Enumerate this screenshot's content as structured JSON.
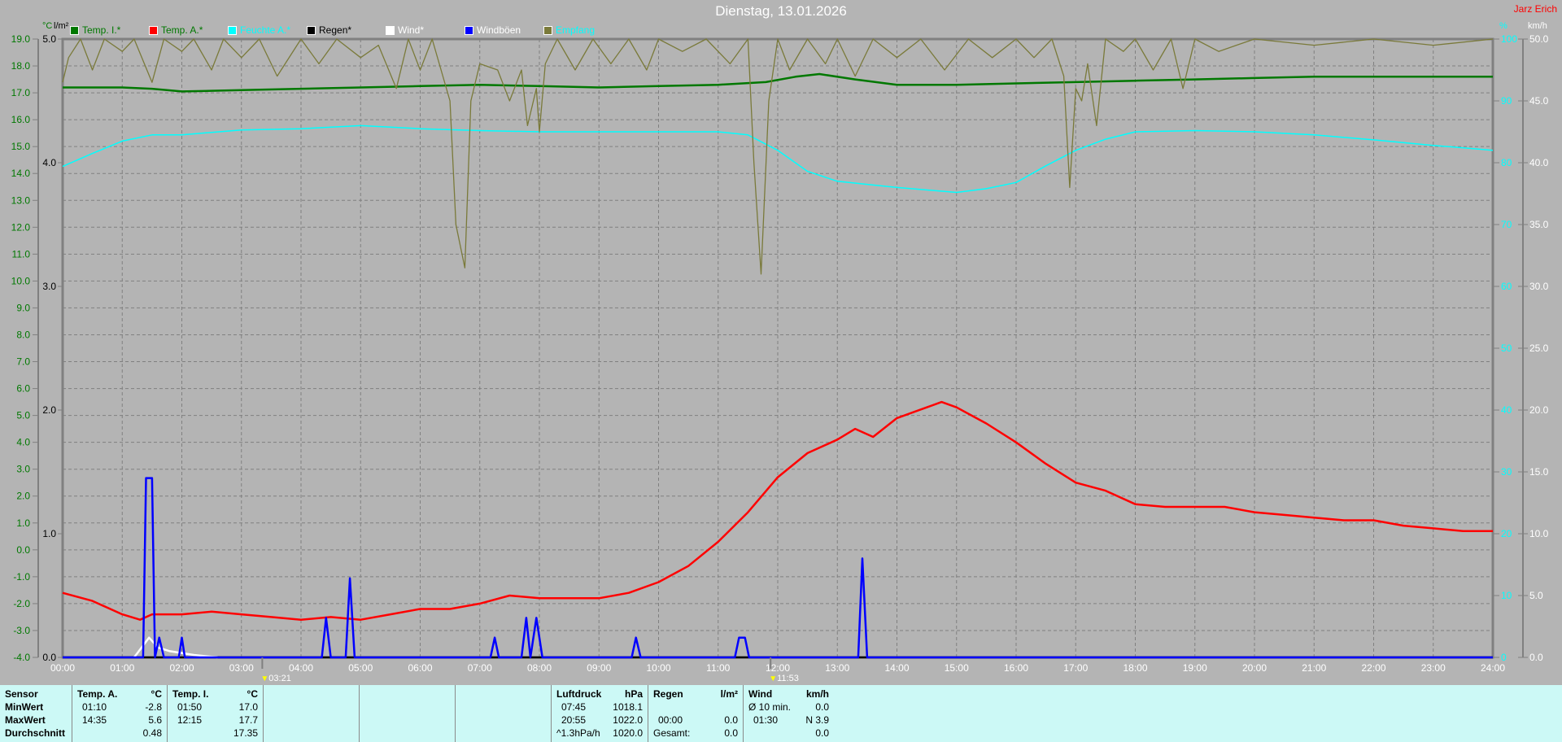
{
  "header": {
    "title": "Dienstag, 13.01.2026",
    "owner": "Jarz Erich"
  },
  "units": {
    "left1": "°C",
    "left2": "l/m²",
    "right1": "%",
    "right2": "km/h"
  },
  "legend": [
    {
      "label": "Temp. I.*",
      "color": "#007800",
      "text_color": "#007800"
    },
    {
      "label": "Temp. A.*",
      "color": "#ff0000",
      "text_color": "#007800"
    },
    {
      "label": "Feuchte A.*",
      "color": "#00ffff",
      "text_color": "#00ffff"
    },
    {
      "label": "Regen*",
      "color": "#000000",
      "text_color": "#000000"
    },
    {
      "label": "Wind*",
      "color": "#ffffff",
      "text_color": "#ffffff"
    },
    {
      "label": "Windböen",
      "color": "#0000ff",
      "text_color": "#ffffff"
    },
    {
      "label": "Empfang",
      "color": "#7a7a3a",
      "text_color": "#00ffff"
    }
  ],
  "markers": [
    {
      "time": "03:21",
      "hour": 3.35
    },
    {
      "time": "11:53",
      "hour": 11.88
    }
  ],
  "chart_data": {
    "type": "line",
    "title": "Dienstag, 13.01.2026",
    "x_range": [
      0,
      24
    ],
    "x_ticks": [
      "00:00",
      "01:00",
      "02:00",
      "03:00",
      "04:00",
      "05:00",
      "06:00",
      "07:00",
      "08:00",
      "09:00",
      "10:00",
      "11:00",
      "12:00",
      "13:00",
      "14:00",
      "15:00",
      "16:00",
      "17:00",
      "18:00",
      "19:00",
      "20:00",
      "21:00",
      "22:00",
      "23:00",
      "24:00"
    ],
    "axes": {
      "temp": {
        "label": "°C",
        "range": [
          -4,
          19
        ],
        "ticks": [
          "19.0",
          "18.0",
          "17.0",
          "16.0",
          "15.0",
          "14.0",
          "13.0",
          "12.0",
          "11.0",
          "10.0",
          "9.0",
          "8.0",
          "7.0",
          "6.0",
          "5.0",
          "4.0",
          "3.0",
          "2.0",
          "1.0",
          "0.0",
          "-1.0",
          "-2.0",
          "-3.0",
          "-4.0"
        ]
      },
      "rain": {
        "label": "l/m²",
        "range": [
          0,
          5
        ],
        "ticks": [
          "5.0",
          "4.0",
          "3.0",
          "2.0",
          "1.0",
          "0.0"
        ]
      },
      "humidity": {
        "label": "%",
        "range": [
          0,
          100
        ],
        "ticks": [
          "100",
          "90",
          "80",
          "70",
          "60",
          "50",
          "40",
          "30",
          "20",
          "10",
          "0"
        ]
      },
      "wind": {
        "label": "km/h",
        "range": [
          0,
          50
        ],
        "ticks": [
          "50.0",
          "45.0",
          "40.0",
          "35.0",
          "30.0",
          "25.0",
          "20.0",
          "15.0",
          "10.0",
          "5.0",
          "0.0"
        ]
      }
    },
    "grid": true,
    "series": [
      {
        "name": "Temp. I.*",
        "axis": "temp",
        "color": "#007800",
        "points": [
          [
            0,
            17.2
          ],
          [
            1,
            17.2
          ],
          [
            1.5,
            17.15
          ],
          [
            2,
            17.05
          ],
          [
            3,
            17.1
          ],
          [
            4,
            17.15
          ],
          [
            5,
            17.2
          ],
          [
            6,
            17.25
          ],
          [
            7,
            17.3
          ],
          [
            8,
            17.25
          ],
          [
            9,
            17.2
          ],
          [
            10,
            17.25
          ],
          [
            11,
            17.3
          ],
          [
            11.8,
            17.4
          ],
          [
            12.3,
            17.6
          ],
          [
            12.7,
            17.7
          ],
          [
            13.3,
            17.5
          ],
          [
            14,
            17.3
          ],
          [
            15,
            17.3
          ],
          [
            16,
            17.35
          ],
          [
            17,
            17.4
          ],
          [
            18,
            17.45
          ],
          [
            19,
            17.5
          ],
          [
            20,
            17.55
          ],
          [
            21,
            17.6
          ],
          [
            22,
            17.6
          ],
          [
            23,
            17.6
          ],
          [
            24,
            17.6
          ]
        ]
      },
      {
        "name": "Temp. A.*",
        "axis": "temp",
        "color": "#ff0000",
        "points": [
          [
            0,
            -1.6
          ],
          [
            0.5,
            -1.9
          ],
          [
            1,
            -2.4
          ],
          [
            1.3,
            -2.6
          ],
          [
            1.5,
            -2.4
          ],
          [
            2,
            -2.4
          ],
          [
            2.5,
            -2.3
          ],
          [
            3,
            -2.4
          ],
          [
            3.5,
            -2.5
          ],
          [
            4,
            -2.6
          ],
          [
            4.5,
            -2.5
          ],
          [
            5,
            -2.6
          ],
          [
            5.5,
            -2.4
          ],
          [
            6,
            -2.2
          ],
          [
            6.5,
            -2.2
          ],
          [
            7,
            -2.0
          ],
          [
            7.5,
            -1.7
          ],
          [
            8,
            -1.8
          ],
          [
            9,
            -1.8
          ],
          [
            9.5,
            -1.6
          ],
          [
            10,
            -1.2
          ],
          [
            10.5,
            -0.6
          ],
          [
            11,
            0.3
          ],
          [
            11.5,
            1.4
          ],
          [
            12,
            2.7
          ],
          [
            12.5,
            3.6
          ],
          [
            13,
            4.1
          ],
          [
            13.3,
            4.5
          ],
          [
            13.6,
            4.2
          ],
          [
            14,
            4.9
          ],
          [
            14.5,
            5.3
          ],
          [
            14.75,
            5.5
          ],
          [
            15,
            5.3
          ],
          [
            15.5,
            4.7
          ],
          [
            16,
            4.0
          ],
          [
            16.5,
            3.2
          ],
          [
            17,
            2.5
          ],
          [
            17.5,
            2.2
          ],
          [
            18,
            1.7
          ],
          [
            18.5,
            1.6
          ],
          [
            19,
            1.6
          ],
          [
            19.5,
            1.6
          ],
          [
            20,
            1.4
          ],
          [
            20.5,
            1.3
          ],
          [
            21,
            1.2
          ],
          [
            21.5,
            1.1
          ],
          [
            22,
            1.1
          ],
          [
            22.5,
            0.9
          ],
          [
            23,
            0.8
          ],
          [
            23.5,
            0.7
          ],
          [
            24,
            0.7
          ]
        ]
      },
      {
        "name": "Feuchte A.*",
        "axis": "humidity",
        "color": "#00ffff",
        "points": [
          [
            0,
            79.4
          ],
          [
            0.5,
            81.5
          ],
          [
            1,
            83.5
          ],
          [
            1.5,
            84.5
          ],
          [
            2,
            84.5
          ],
          [
            3,
            85.3
          ],
          [
            4,
            85.5
          ],
          [
            5,
            86
          ],
          [
            6,
            85.5
          ],
          [
            7,
            85.2
          ],
          [
            8,
            85
          ],
          [
            9,
            85
          ],
          [
            10,
            85
          ],
          [
            11,
            85
          ],
          [
            11.5,
            84.5
          ],
          [
            12,
            82
          ],
          [
            12.5,
            78.6
          ],
          [
            13,
            77
          ],
          [
            13.5,
            76.5
          ],
          [
            14,
            76
          ],
          [
            15,
            75.2
          ],
          [
            15.5,
            75.8
          ],
          [
            16,
            76.8
          ],
          [
            16.5,
            79.5
          ],
          [
            17,
            82
          ],
          [
            17.5,
            83.8
          ],
          [
            18,
            85
          ],
          [
            19,
            85.2
          ],
          [
            20,
            85
          ],
          [
            21,
            84.5
          ],
          [
            22,
            83.7
          ],
          [
            23,
            82.8
          ],
          [
            24,
            82
          ]
        ]
      },
      {
        "name": "Regen*",
        "axis": "rain",
        "color": "#000000",
        "points": [
          [
            0,
            0
          ],
          [
            24,
            0
          ]
        ]
      },
      {
        "name": "Wind*",
        "axis": "wind",
        "color": "#ffffff",
        "points": [
          [
            1.2,
            0
          ],
          [
            1.45,
            1.6
          ],
          [
            1.6,
            0.8
          ],
          [
            1.8,
            0.5
          ],
          [
            2.2,
            0.2
          ],
          [
            2.6,
            0
          ]
        ]
      },
      {
        "name": "Windböen",
        "axis": "wind",
        "color": "#0000ff",
        "points": [
          [
            0,
            0
          ],
          [
            1.35,
            0
          ],
          [
            1.4,
            14.5
          ],
          [
            1.5,
            14.5
          ],
          [
            1.55,
            0
          ],
          [
            1.62,
            1.6
          ],
          [
            1.7,
            0
          ],
          [
            1.95,
            0
          ],
          [
            2,
            1.6
          ],
          [
            2.05,
            0
          ],
          [
            4.35,
            0
          ],
          [
            4.42,
            3.2
          ],
          [
            4.5,
            0
          ],
          [
            4.75,
            0
          ],
          [
            4.82,
            6.4
          ],
          [
            4.9,
            0
          ],
          [
            7.18,
            0
          ],
          [
            7.25,
            1.6
          ],
          [
            7.32,
            0
          ],
          [
            7.7,
            0
          ],
          [
            7.78,
            3.2
          ],
          [
            7.85,
            0
          ],
          [
            7.95,
            3.2
          ],
          [
            8.05,
            0
          ],
          [
            9.55,
            0
          ],
          [
            9.62,
            1.6
          ],
          [
            9.7,
            0
          ],
          [
            11.28,
            0
          ],
          [
            11.35,
            1.6
          ],
          [
            11.45,
            1.6
          ],
          [
            11.52,
            0
          ],
          [
            13.35,
            0
          ],
          [
            13.42,
            8.0
          ],
          [
            13.5,
            0
          ],
          [
            24,
            0
          ]
        ]
      },
      {
        "name": "Empfang",
        "axis": "humidity",
        "color": "#7a7a3a",
        "points": [
          [
            0,
            93
          ],
          [
            0.1,
            97
          ],
          [
            0.3,
            100
          ],
          [
            0.5,
            95
          ],
          [
            0.7,
            100
          ],
          [
            1,
            98
          ],
          [
            1.2,
            100
          ],
          [
            1.5,
            93
          ],
          [
            1.7,
            100
          ],
          [
            2,
            98
          ],
          [
            2.2,
            100
          ],
          [
            2.5,
            95
          ],
          [
            2.7,
            100
          ],
          [
            3,
            97
          ],
          [
            3.3,
            100
          ],
          [
            3.6,
            94
          ],
          [
            4,
            100
          ],
          [
            4.3,
            96
          ],
          [
            4.6,
            100
          ],
          [
            5,
            97
          ],
          [
            5.3,
            99
          ],
          [
            5.6,
            92
          ],
          [
            5.8,
            100
          ],
          [
            6,
            95
          ],
          [
            6.2,
            100
          ],
          [
            6.5,
            90
          ],
          [
            6.6,
            70
          ],
          [
            6.75,
            63
          ],
          [
            6.85,
            90
          ],
          [
            7,
            96
          ],
          [
            7.3,
            95
          ],
          [
            7.5,
            90
          ],
          [
            7.7,
            95
          ],
          [
            7.8,
            86
          ],
          [
            7.95,
            92
          ],
          [
            8,
            85
          ],
          [
            8.1,
            96
          ],
          [
            8.3,
            100
          ],
          [
            8.6,
            95
          ],
          [
            8.9,
            100
          ],
          [
            9.2,
            96
          ],
          [
            9.5,
            100
          ],
          [
            9.8,
            95
          ],
          [
            10,
            100
          ],
          [
            10.4,
            98
          ],
          [
            10.8,
            100
          ],
          [
            11.2,
            96
          ],
          [
            11.5,
            100
          ],
          [
            11.6,
            80
          ],
          [
            11.72,
            62
          ],
          [
            11.85,
            90
          ],
          [
            12,
            100
          ],
          [
            12.2,
            95
          ],
          [
            12.5,
            100
          ],
          [
            12.8,
            96
          ],
          [
            13,
            100
          ],
          [
            13.3,
            94
          ],
          [
            13.6,
            100
          ],
          [
            14,
            97
          ],
          [
            14.4,
            100
          ],
          [
            14.8,
            95
          ],
          [
            15.2,
            100
          ],
          [
            15.6,
            97
          ],
          [
            16,
            100
          ],
          [
            16.3,
            97
          ],
          [
            16.6,
            100
          ],
          [
            16.8,
            94
          ],
          [
            16.9,
            76
          ],
          [
            17,
            92
          ],
          [
            17.1,
            90
          ],
          [
            17.2,
            96
          ],
          [
            17.35,
            86
          ],
          [
            17.5,
            100
          ],
          [
            17.8,
            98
          ],
          [
            18,
            100
          ],
          [
            18.3,
            95
          ],
          [
            18.6,
            100
          ],
          [
            18.8,
            92
          ],
          [
            19,
            100
          ],
          [
            19.4,
            98
          ],
          [
            20,
            100
          ],
          [
            21,
            99
          ],
          [
            22,
            100
          ],
          [
            23,
            99
          ],
          [
            24,
            100
          ]
        ]
      }
    ]
  },
  "table": {
    "sensor": {
      "header": "Sensor",
      "rows": [
        "MinWert",
        "MaxWert",
        "Durchschnitt"
      ]
    },
    "temp_a": {
      "header": "Temp. A.",
      "unit": "°C",
      "min_time": "01:10",
      "min": "-2.8",
      "max_time": "14:35",
      "max": "5.6",
      "avg": "0.48"
    },
    "temp_i": {
      "header": "Temp. I.",
      "unit": "°C",
      "min_time": "01:50",
      "min": "17.0",
      "max_time": "12:15",
      "max": "17.7",
      "avg": "17.35"
    },
    "pressure": {
      "header": "Luftdruck",
      "unit": "hPa",
      "min_time": "07:45",
      "min": "1018.1",
      "max_time": "20:55",
      "max": "1022.0",
      "trend": "^1.3hPa/h",
      "current": "1020.0"
    },
    "rain": {
      "header": "Regen",
      "unit": "l/m²",
      "time": "00:00",
      "value": "0.0",
      "total_label": "Gesamt:",
      "total": "0.0"
    },
    "wind": {
      "header": "Wind",
      "unit": "km/h",
      "avg_label": "Ø 10 min.",
      "avg": "0.0",
      "max_time": "01:30",
      "max": "N 3.9",
      "extra": "0.0"
    }
  }
}
